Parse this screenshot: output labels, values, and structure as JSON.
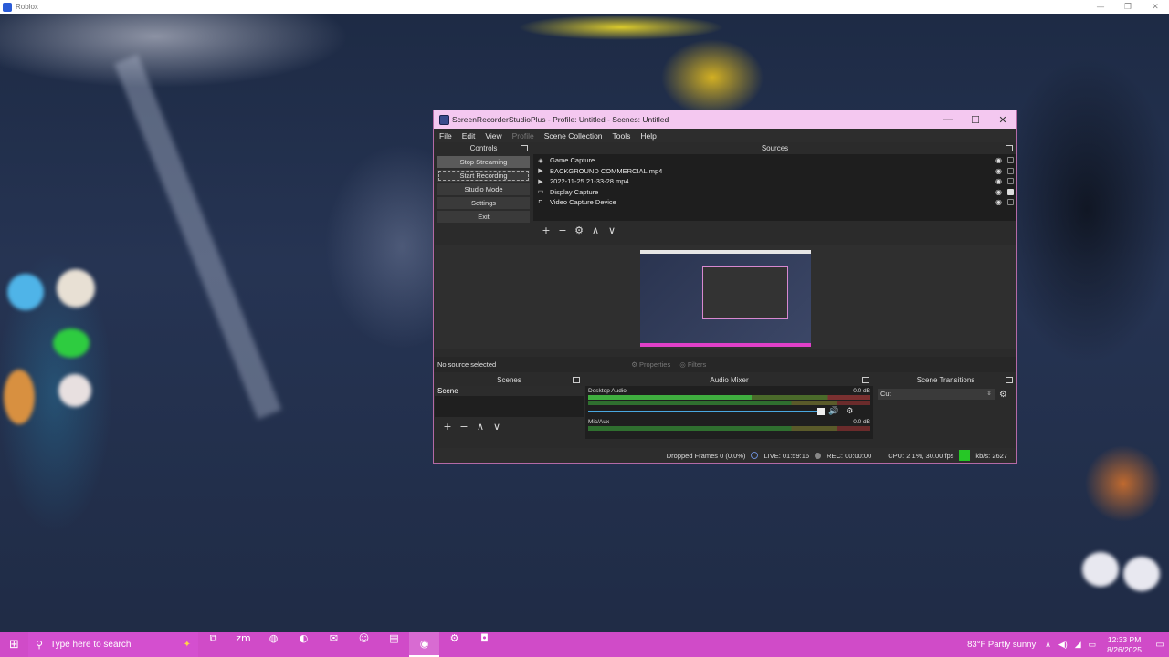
{
  "roblox": {
    "title": "Roblox",
    "min": "—",
    "max": "❐",
    "close": "✕"
  },
  "obs": {
    "title": "ScreenRecorderStudioPlus - Profile: Untitled - Scenes: Untitled",
    "menu": [
      "File",
      "Edit",
      "View",
      "Profile",
      "Scene Collection",
      "Tools",
      "Help"
    ],
    "controls": {
      "header": "Controls",
      "buttons": [
        "Stop Streaming",
        "Start Recording",
        "Studio Mode",
        "Settings",
        "Exit"
      ]
    },
    "sources": {
      "header": "Sources",
      "items": [
        {
          "name": "Game Capture",
          "icon": "gamepad-icon",
          "locked": false
        },
        {
          "name": "BACKGROUND COMMERCIAL.mp4",
          "icon": "play-icon",
          "locked": false
        },
        {
          "name": "2022-11-25 21-33-28.mp4",
          "icon": "play-icon",
          "locked": false
        },
        {
          "name": "Display Capture",
          "icon": "monitor-icon",
          "locked": true
        },
        {
          "name": "Video Capture Device",
          "icon": "camera-icon",
          "locked": false
        }
      ]
    },
    "status_left": "No source selected",
    "properties": "Properties",
    "filters": "Filters",
    "scenes": {
      "header": "Scenes",
      "items": [
        "Scene"
      ]
    },
    "mixer": {
      "header": "Audio Mixer",
      "channels": [
        {
          "name": "Desktop Audio",
          "db": "0.0 dB"
        },
        {
          "name": "Mic/Aux",
          "db": "0.0 dB"
        }
      ]
    },
    "transitions": {
      "header": "Scene Transitions",
      "selected": "Cut"
    },
    "statusbar": {
      "dropped": "Dropped Frames 0 (0.0%)",
      "live": "LIVE: 01:59:16",
      "rec": "REC: 00:00:00",
      "cpu": "CPU: 2.1%, 30.00 fps",
      "kbps": "kb/s: 2627"
    }
  },
  "taskbar": {
    "search_placeholder": "Type here to search",
    "weather": "83°F  Partly sunny",
    "time": "12:33 PM",
    "date": "8/26/2025"
  }
}
